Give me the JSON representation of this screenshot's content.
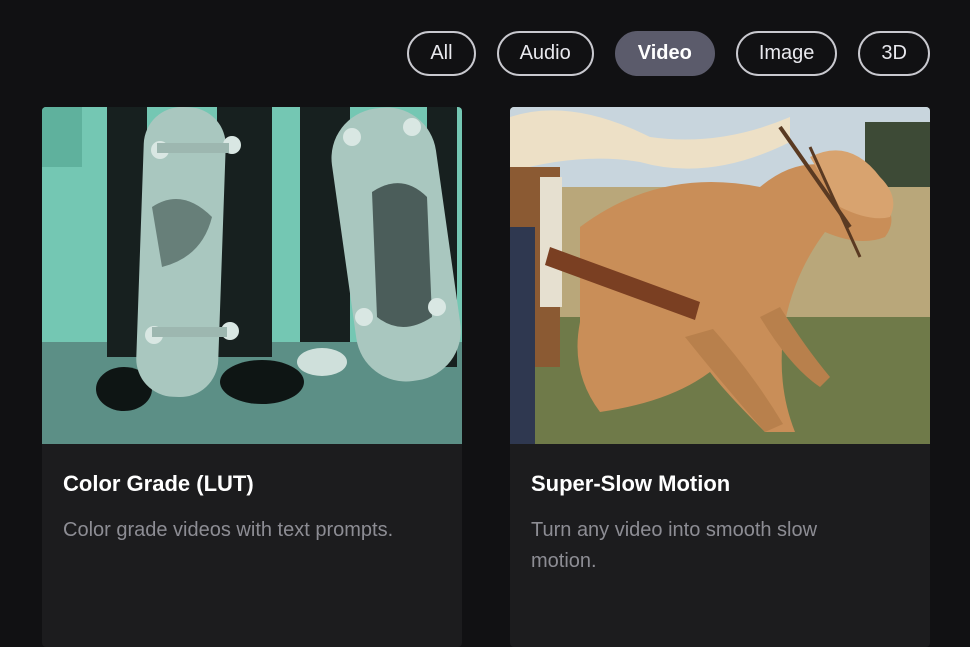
{
  "filters": {
    "items": [
      "All",
      "Audio",
      "Video",
      "Image",
      "3D"
    ],
    "active": "Video"
  },
  "cards": [
    {
      "title": "Color Grade (LUT)",
      "description": "Color grade videos with text prompts.",
      "image_subject": "two people holding skateboards, teal color graded"
    },
    {
      "title": "Super-Slow Motion",
      "description": "Turn any video into smooth slow motion.",
      "image_subject": "palomino horse galloping across a field"
    }
  ],
  "colors": {
    "background": "#111113",
    "card": "#1c1c1e",
    "active_chip": "#5b5b6b",
    "chip_border": "#c9c9cf",
    "muted_text": "#8d8d94",
    "teal_grade": "#6fc6b3",
    "horse": "#c98e58"
  }
}
